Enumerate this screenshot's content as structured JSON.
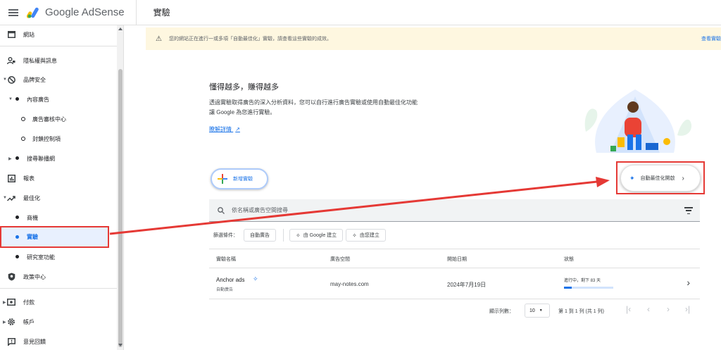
{
  "topbar": {
    "brand": "Google AdSense",
    "page_title": "實驗"
  },
  "sidebar": {
    "items": [
      {
        "label": "網站",
        "icon": "site-icon"
      },
      {
        "label": "隱私權與訊息",
        "icon": "privacy-icon"
      },
      {
        "label": "品牌安全",
        "icon": "block-icon"
      },
      {
        "label": "內容廣告"
      },
      {
        "label": "廣告審核中心"
      },
      {
        "label": "封鎖控制項"
      },
      {
        "label": "搜尋聯播網"
      },
      {
        "label": "報表",
        "icon": "report-icon"
      },
      {
        "label": "最佳化",
        "icon": "trending-icon"
      },
      {
        "label": "商機"
      },
      {
        "label": "實驗"
      },
      {
        "label": "研究室功能"
      },
      {
        "label": "政策中心",
        "icon": "policy-icon"
      },
      {
        "label": "付款",
        "icon": "payment-icon"
      },
      {
        "label": "帳戶",
        "icon": "gear-icon"
      },
      {
        "label": "意見回饋",
        "icon": "feedback-icon"
      }
    ]
  },
  "banner": {
    "text": "您的網站正在進行一或多項「自動最佳化」實驗，請查看這些實驗的成效。",
    "link": "查看實驗"
  },
  "hero": {
    "title": "懂得越多，賺得越多",
    "desc_line1": "透過實驗取得廣告的深入分析資料，您可以自行進行廣告實驗或使用自動最佳化功能",
    "desc_line2": "讓 Google 為您進行實驗。",
    "link": "瞭解詳情"
  },
  "actions": {
    "new_experiment": "新增實驗",
    "auto_optimize": "自動最佳化開啟"
  },
  "search": {
    "placeholder": "依名稱或廣告空間搜尋"
  },
  "filters": {
    "label": "篩選條件：",
    "chips": [
      "自動廣告",
      "由 Google 建立",
      "由您建立"
    ]
  },
  "table": {
    "headers": [
      "實驗名稱",
      "廣告空間",
      "開始日期",
      "狀態"
    ],
    "rows": [
      {
        "name": "Anchor ads",
        "type": "自動廣告",
        "space": "may-notes.com",
        "date": "2024年7月19日",
        "status": "進行中，剩下 83 天",
        "progress": 0.15
      }
    ]
  },
  "pager": {
    "rows_label": "顯示列數：",
    "rows_value": "10",
    "range": "第 1 到 1 列 (共 1 列)"
  },
  "colors": {
    "accent": "#1a73e8",
    "annotation": "#e53935",
    "banner_bg": "#fef7e0"
  }
}
